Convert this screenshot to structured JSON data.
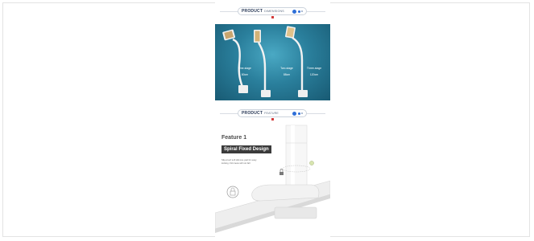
{
  "header_top": {
    "bold": "PRODUCT",
    "sub": "DIMENSIONS"
  },
  "header_feature": {
    "bold": "PRODUCT",
    "sub": "FEATURE"
  },
  "dimensions": [
    {
      "name": "One-stage",
      "size": "80cm"
    },
    {
      "name": "Two-stage",
      "size": "88cm"
    },
    {
      "name": "Three-stage",
      "size": "120cm"
    }
  ],
  "feature": {
    "title": "Feature 1",
    "badge": "Spiral Fixed Design",
    "desc": "Slip-proof soft silicone pad for easy locking. Firmness will not fall"
  },
  "colors": {
    "brand": "#2a3a58",
    "accent": "#2f6fd8",
    "panel": "#2a7f9c",
    "badge": "#3b3b3b"
  }
}
